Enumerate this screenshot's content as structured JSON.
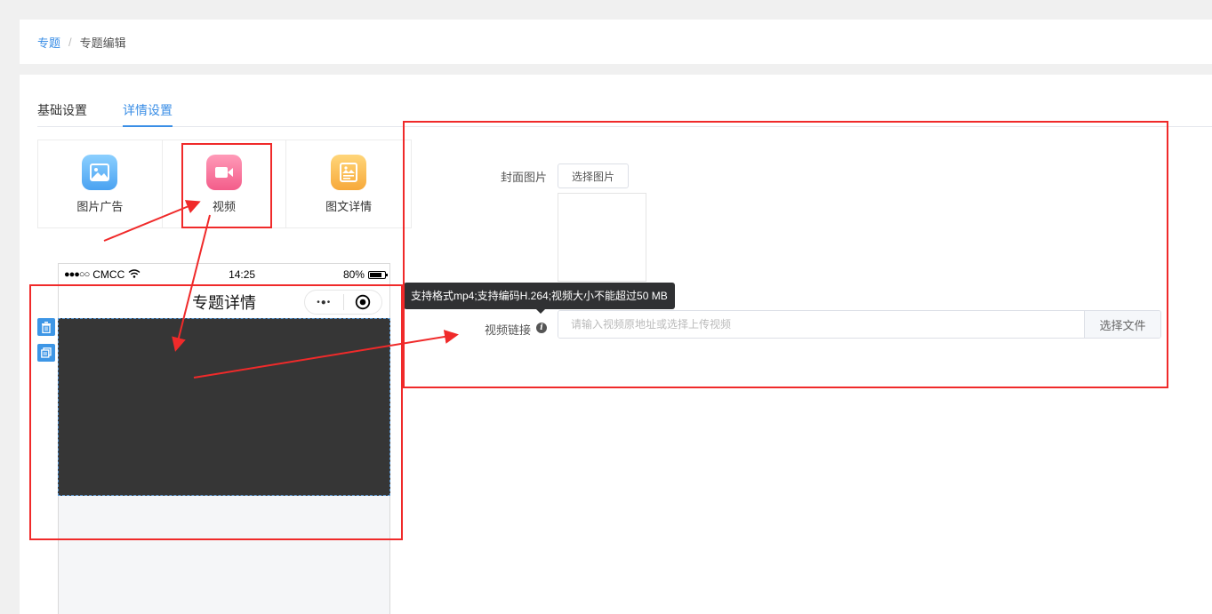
{
  "breadcrumb": {
    "root": "专题",
    "separator": "/",
    "current": "专题编辑"
  },
  "tabs": [
    {
      "label": "基础设置",
      "active": false
    },
    {
      "label": "详情设置",
      "active": true
    }
  ],
  "widgets": [
    {
      "label": "图片广告",
      "icon": "image-ad-icon",
      "color": "#4aa2f1"
    },
    {
      "label": "视频",
      "icon": "video-camera-icon",
      "color": "#f35d8a"
    },
    {
      "label": "图文详情",
      "icon": "rich-text-icon",
      "color": "#f7a93a"
    }
  ],
  "phone": {
    "carrier": "CMCC",
    "time": "14:25",
    "battery": "80%",
    "battery_level": 0.8,
    "title": "专题详情",
    "more_glyph": "•●•"
  },
  "form": {
    "cover_label": "封面图片",
    "cover_button": "选择图片",
    "video_label": "视频链接",
    "video_placeholder": "请输入视频原地址或选择上传视频",
    "video_value": "",
    "file_button": "选择文件",
    "tooltip": "支持格式mp4;支持编码H.264;视频大小不能超过50 MB"
  },
  "colors": {
    "accent": "#3a8ee6",
    "annotation": "#f02a2a",
    "video_placeholder_bg": "#363636"
  }
}
